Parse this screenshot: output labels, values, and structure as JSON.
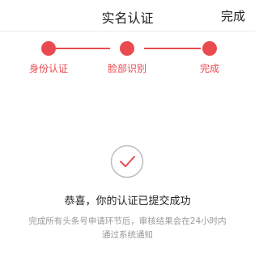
{
  "header": {
    "title": "实名认证",
    "action_label": "完成"
  },
  "steps": [
    {
      "label": "身份认证",
      "done": true
    },
    {
      "label": "脸部识别",
      "done": true
    },
    {
      "label": "完成",
      "done": true
    }
  ],
  "result": {
    "title": "恭喜，你的认证已提交成功",
    "description_line1": "完成所有头条号申请环节后，审核结果会在24小时内",
    "description_line2": "通过系统通知"
  },
  "colors": {
    "accent": "#e84a4f",
    "icon_gray": "#bdbdbd",
    "muted_text": "#9a9a9a"
  },
  "icons": {
    "status": "check-circle-icon"
  }
}
